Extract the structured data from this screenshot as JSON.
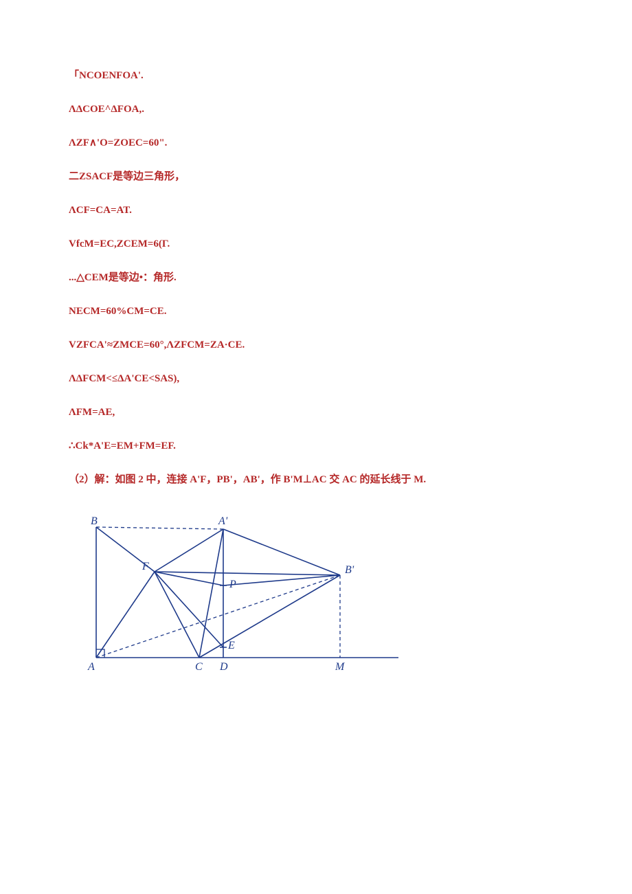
{
  "lines": {
    "l1": "「NCOENFOA'.",
    "l2": "ΛΔCOE^ΔFOA,.",
    "l3": "ΛZF∧'O=ZOEC=60\".",
    "l4": "二ZSACF是等边三角形，",
    "l5": "ΛCF=CA=AT.",
    "l6": "VfcM=EC,ZCEM=6(Γ.",
    "l7": "...△CEM是等边•：角形.",
    "l8": "NECM=60%CM=CE.",
    "l9": "VZFCA'≈ZMCE=60°,ΛZFCM=ZA·CE.",
    "l10": "ΛΔFCM<≤ΔA'CE<SAS),",
    "l11": "ΛFM=AE,",
    "l12": "∴Ck*A'E=EM+FM=EF.",
    "l13": "（2）解：如图 2 中，连接 A'F，PB'，AB'，作 B'M⊥AC 交 AC 的延长线于 M."
  },
  "figure": {
    "labels": {
      "B": "B",
      "Ap": "A'",
      "F": "F",
      "P": "P",
      "Bp": "B'",
      "A": "A",
      "C": "C",
      "D": "D",
      "E": "E",
      "M": "M"
    }
  }
}
